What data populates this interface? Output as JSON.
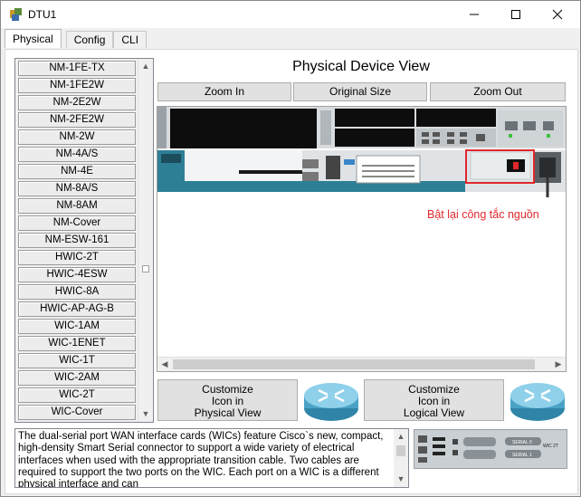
{
  "window": {
    "title": "DTU1",
    "minimize": "—",
    "maximize": "☐",
    "close": "✕"
  },
  "tabs": [
    {
      "label": "Physical",
      "active": true
    },
    {
      "label": "Config",
      "active": false
    },
    {
      "label": "CLI",
      "active": false
    }
  ],
  "modules": [
    "NM-1FE-TX",
    "NM-1FE2W",
    "NM-2E2W",
    "NM-2FE2W",
    "NM-2W",
    "NM-4A/S",
    "NM-4E",
    "NM-8A/S",
    "NM-8AM",
    "NM-Cover",
    "NM-ESW-161",
    "HWIC-2T",
    "HWIC-4ESW",
    "HWIC-8A",
    "HWIC-AP-AG-B",
    "WIC-1AM",
    "WIC-1ENET",
    "WIC-1T",
    "WIC-2AM",
    "WIC-2T",
    "WIC-Cover"
  ],
  "device_view": {
    "title": "Physical Device View",
    "zoom_in": "Zoom In",
    "original_size": "Original Size",
    "zoom_out": "Zoom Out",
    "annotation": "Bật lại công tắc nguồn",
    "router_brand": "CISCO"
  },
  "customize_physical": "Customize\nIcon in\nPhysical View",
  "customize_logical": "Customize\nIcon in\nLogical View",
  "customize_physical_lines": [
    "Customize",
    "Icon in",
    "Physical View"
  ],
  "customize_logical_lines": [
    "Customize",
    "Icon in",
    "Logical View"
  ],
  "description": "The dual-serial port WAN interface cards (WICs) feature Cisco`s new, compact, high-density Smart Serial connector to support a wide variety of electrical interfaces when used with the appropriate transition cable. Two cables are required to support the two ports on the WIC. Each port on a WIC is a different physical interface and can",
  "module_image_labels": {
    "serial0": "SERIAL 0",
    "serial1": "SERIAL 1",
    "conn": "CONN",
    "wic": "WIC 2T"
  },
  "colors": {
    "annotation": "#e0282d",
    "router_teal": "#2d7f95",
    "highlight_box": "#e0282d"
  }
}
